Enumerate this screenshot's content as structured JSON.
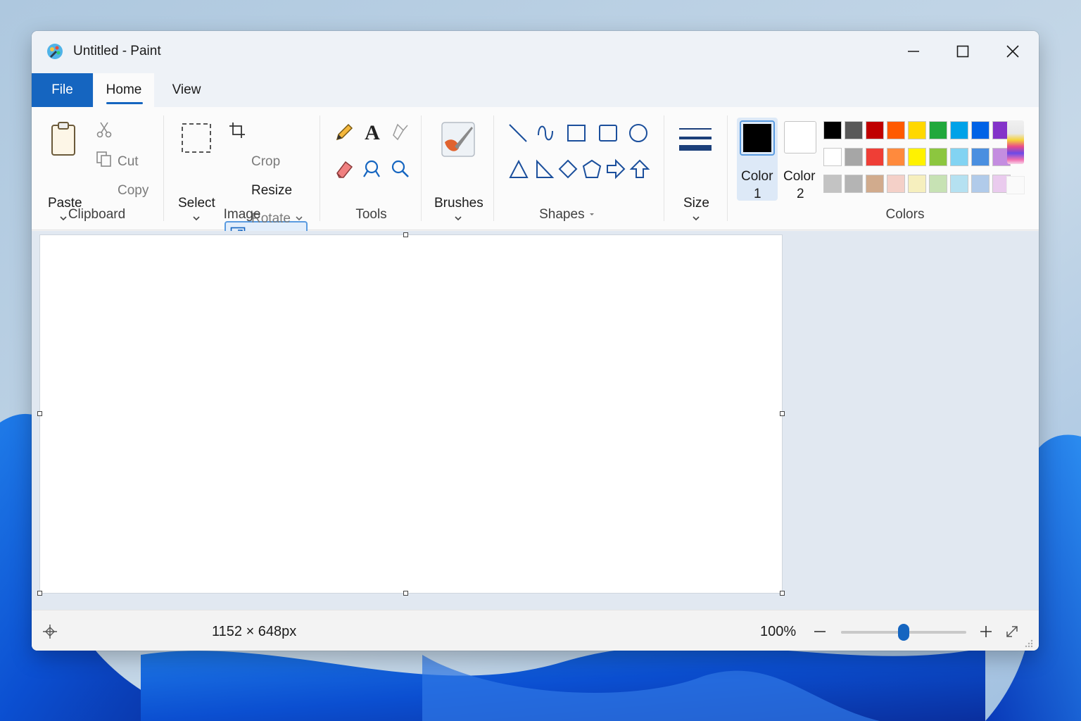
{
  "window": {
    "title": "Untitled - Paint"
  },
  "menu": {
    "file": "File",
    "home": "Home",
    "view": "View"
  },
  "ribbon": {
    "clipboard": {
      "label": "Clipboard",
      "paste": "Paste",
      "cut": "Cut",
      "copy": "Copy"
    },
    "image": {
      "label": "Image",
      "select": "Select",
      "crop": "Crop",
      "resize": "Resize",
      "rotate": "Rotate"
    },
    "tools": {
      "label": "Tools",
      "items": [
        "pencil-icon",
        "text-icon",
        "fill-icon",
        "eraser-icon",
        "color-picker-icon",
        "magnifier-icon"
      ]
    },
    "brushes": {
      "label": "Brushes"
    },
    "shapes": {
      "label": "Shapes",
      "items": [
        "line",
        "curve",
        "rectangle",
        "rounded-rectangle",
        "oval",
        "triangle",
        "right-triangle",
        "diamond",
        "pentagon",
        "right-arrow",
        "up-arrow"
      ]
    },
    "size": {
      "label": "Size"
    },
    "colors": {
      "label": "Colors",
      "color1_line1": "Color",
      "color1_line2": "1",
      "color2_line1": "Color",
      "color2_line2": "2",
      "color1_value": "#000000",
      "color2_value": "#ffffff",
      "palette": [
        [
          "#000000",
          "#595959",
          "#c00000",
          "#ff5a00",
          "#ffd800",
          "#21a83c",
          "#00a2e8",
          "#0063e6",
          "#8433c9"
        ],
        [
          "#ffffff",
          "#a6a6a6",
          "#ef3e36",
          "#ff8a3d",
          "#fff200",
          "#8cc63f",
          "#82d3f2",
          "#4a8fe0",
          "#c48de0"
        ],
        [
          "#c3c3c3",
          "#b4b4b4",
          "#d1ab8d",
          "#f4d0c8",
          "#f6efbe",
          "#c7e2b4",
          "#b5e1f1",
          "#b1cbea",
          "#eacbee"
        ]
      ]
    }
  },
  "status": {
    "dimensions": "1152 × 648px",
    "zoom": "100%",
    "zoom_level": 100
  }
}
